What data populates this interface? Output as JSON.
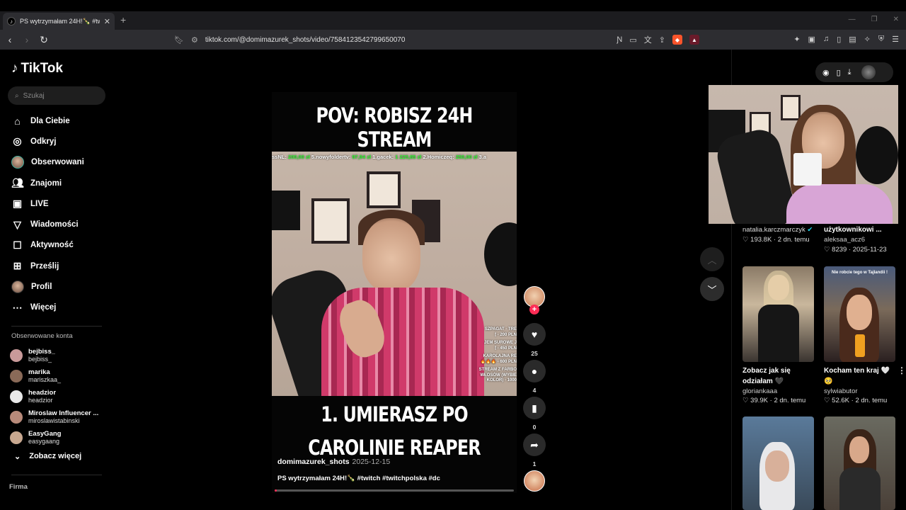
{
  "browser": {
    "tab_title": "PS wytrzymałam 24H!🍾 #twi",
    "url": "tiktok.com/@domimazurek_shots/video/7584123542799650070",
    "badge_count": "1"
  },
  "tiktok": {
    "logo_text": "TikTok",
    "search_placeholder": "Szukaj",
    "nav": [
      {
        "label": "Dla Ciebie",
        "icon": "home-icon"
      },
      {
        "label": "Odkryj",
        "icon": "compass-icon"
      },
      {
        "label": "Obserwowani",
        "icon": "following-avatar"
      },
      {
        "label": "Znajomi",
        "icon": "friends-icon"
      },
      {
        "label": "LIVE",
        "icon": "live-icon"
      },
      {
        "label": "Wiadomości",
        "icon": "send-icon"
      },
      {
        "label": "Aktywność",
        "icon": "activity-icon"
      },
      {
        "label": "Prześlij",
        "icon": "upload-icon"
      },
      {
        "label": "Profil",
        "icon": "profile-avatar"
      },
      {
        "label": "Więcej",
        "icon": "more-icon"
      }
    ],
    "followed_title": "Obserwowane konta",
    "followed": [
      {
        "name": "bejbiss_",
        "username": "bejbiss_",
        "color": "#c99a9a"
      },
      {
        "name": "marika",
        "username": "mariszkaa_",
        "color": "#8a6a58"
      },
      {
        "name": "headzior",
        "username": "headzior",
        "color": "#e8e8e8"
      },
      {
        "name": "Miroslaw Influencer ...",
        "username": "miroslawistabinski",
        "color": "#b88a7a"
      },
      {
        "name": "EasyGang",
        "username": "easygaang",
        "color": "#c8a890"
      }
    ],
    "see_more": "Zobacz więcej",
    "company": "Firma"
  },
  "video": {
    "headline": "POV: ROBISZ 24H STREAM",
    "ticker_segments": [
      {
        "text": "ssNL: ",
        "green": false
      },
      {
        "text": "200,00 zł",
        "green": true
      },
      {
        "text": " 5.nowyfoldertv: ",
        "green": false
      },
      {
        "text": "97,94 zł",
        "green": true
      },
      {
        "text": " 1.gacek: ",
        "green": false
      },
      {
        "text": "1 225,85 zł",
        "green": true
      },
      {
        "text": " 2.Homiczeq: ",
        "green": false
      },
      {
        "text": "250,00 zł",
        "green": true
      },
      {
        "text": " 3.a",
        "green": false
      }
    ],
    "overlay_lines": [
      "SZPAGAT - TRE\n🕯 - 200 PLN",
      "JEM SUROWE J\n🕯 - 450 PLN",
      "KAROLAJNA RE\n🔥🔥🔥 - 600 PLN",
      "STREAM Z FARBO\nWŁOSÓW (WYBIE\nKOLOR) - 1000"
    ],
    "caption_line1": "1. UMIERASZ PO",
    "caption_line2": "CAROLINIE REAPER",
    "author": "domimazurek_shots",
    "date": "2025-12-15",
    "description": "PS wytrzymałam 24H!🍾 #twitch #twitchpolska #dc",
    "progress": 0.01
  },
  "actions": {
    "likes": "25",
    "comments": "4",
    "saves": "0",
    "shares": "1"
  },
  "recommendations": {
    "top_left": {
      "user": "natalia.karczmarczyk",
      "verified": true,
      "likes": "193.8K",
      "date": "2 dn. temu"
    },
    "top_right": {
      "title": "użytkownikowi ...",
      "user": "aleksaa_acz6",
      "likes": "8239",
      "date": "2025-11-23"
    },
    "cards": [
      {
        "title": "Zobacz jak się odziałam 🖤",
        "user": "gloriankaaa",
        "likes": "39.9K",
        "date": "2 dn. temu",
        "overlay": ""
      },
      {
        "title": "Kocham ten kraj 🤍 🥺",
        "user": "sylwiabutor",
        "likes": "52.6K",
        "date": "2 dn. temu",
        "overlay": "Nie robcie tego w Tajlandii !"
      },
      {
        "title": "",
        "user": "",
        "likes": "",
        "date": "",
        "overlay": ""
      },
      {
        "title": "",
        "user": "",
        "likes": "",
        "date": "",
        "overlay": ""
      }
    ]
  }
}
